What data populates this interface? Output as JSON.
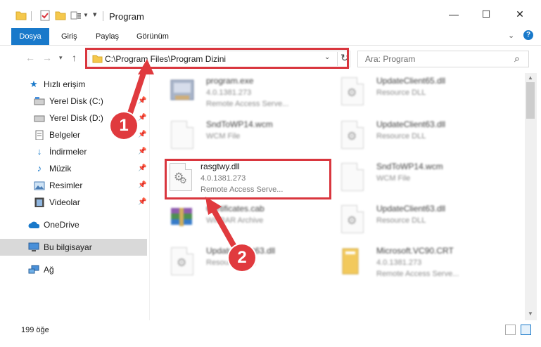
{
  "window": {
    "title": "Program",
    "minimize": "—",
    "maximize": "☐",
    "close": "✕"
  },
  "ribbon": {
    "tabs": [
      "Dosya",
      "Giriş",
      "Paylaş",
      "Görünüm"
    ],
    "help": "?"
  },
  "address": {
    "path": "C:\\Program Files\\Program Dizini",
    "search_placeholder": "Ara: Program"
  },
  "sidebar": {
    "items": [
      {
        "label": "Hızlı erişim",
        "icon": "star-icon"
      },
      {
        "label": "Yerel Disk (C:)",
        "icon": "drive-icon"
      },
      {
        "label": "Yerel Disk (D:)",
        "icon": "drive-icon"
      },
      {
        "label": "Belgeler",
        "icon": "document-icon"
      },
      {
        "label": "İndirmeler",
        "icon": "download-icon"
      },
      {
        "label": "Müzik",
        "icon": "music-icon"
      },
      {
        "label": "Resimler",
        "icon": "pictures-icon"
      },
      {
        "label": "Videolar",
        "icon": "video-icon"
      },
      {
        "label": "OneDrive",
        "icon": "cloud-icon"
      },
      {
        "label": "Bu bilgisayar",
        "icon": "computer-icon"
      },
      {
        "label": "Ağ",
        "icon": "network-icon"
      }
    ]
  },
  "files": [
    {
      "name": "program.exe",
      "line2": "4.0.1381.273",
      "line3": "Remote Access Serve..."
    },
    {
      "name": "UpdateClient65.dll",
      "line2": "Resource DLL",
      "line3": ""
    },
    {
      "name": "SndToWP14.wcm",
      "line2": "WCM File",
      "line3": ""
    },
    {
      "name": "UpdateClient63.dll",
      "line2": "Resource DLL",
      "line3": ""
    },
    {
      "name": "rasgtwy.dll",
      "line2": "4.0.1381.273",
      "line3": "Remote Access Serve..."
    },
    {
      "name": "SndToWP14.wcm",
      "line2": "WCM File",
      "line3": ""
    },
    {
      "name": "Certificates.cab",
      "line2": "WinRAR Archive",
      "line3": ""
    },
    {
      "name": "UpdateClient63.dll",
      "line2": "Resource DLL",
      "line3": ""
    },
    {
      "name": "UpdateClient63.dll",
      "line2": "Resource DLL",
      "line3": ""
    },
    {
      "name": "Microsoft.VC90.CRT",
      "line2": "4.0.1381.273",
      "line3": "Remote Access Serve..."
    }
  ],
  "status": {
    "count": "199 öğe"
  },
  "markers": [
    "1",
    "2"
  ],
  "colors": {
    "accent": "#1979ca",
    "highlight": "#d9363e",
    "marker": "#e03a3e"
  }
}
